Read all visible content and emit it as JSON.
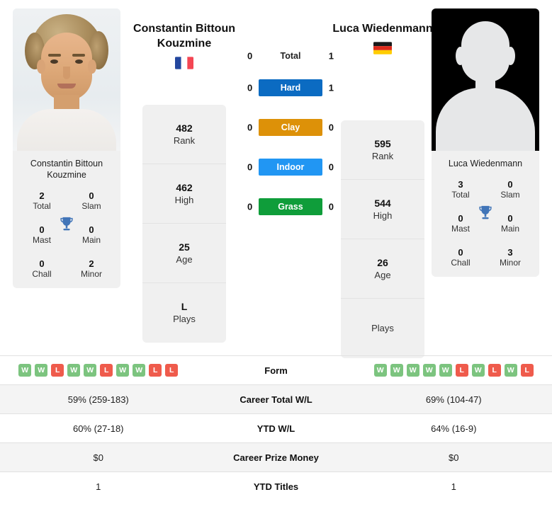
{
  "players": {
    "left": {
      "name": "Constantin Bittoun Kouzmine",
      "caption": "Constantin Bittoun Kouzmine",
      "flag": "fr",
      "flag_name": "france-flag",
      "photo_type": "headshot",
      "titles": [
        {
          "value": "2",
          "label": "Total"
        },
        {
          "value": "0",
          "label": "Slam"
        },
        {
          "value": "0",
          "label": "Mast"
        },
        {
          "value": "0",
          "label": "Main"
        },
        {
          "value": "0",
          "label": "Chall"
        },
        {
          "value": "2",
          "label": "Minor"
        }
      ],
      "card": [
        {
          "value": "482",
          "label": "Rank"
        },
        {
          "value": "462",
          "label": "High"
        },
        {
          "value": "25",
          "label": "Age"
        },
        {
          "value": "L",
          "label": "Plays"
        }
      ],
      "form": [
        "W",
        "W",
        "L",
        "W",
        "W",
        "L",
        "W",
        "W",
        "L",
        "L"
      ],
      "career_wl": "59% (259-183)",
      "ytd_wl": "60% (27-18)",
      "prize_money": "$0",
      "ytd_titles": "1"
    },
    "right": {
      "name": "Luca Wiedenmann",
      "caption": "Luca Wiedenmann",
      "flag": "de",
      "flag_name": "germany-flag",
      "photo_type": "silhouette",
      "titles": [
        {
          "value": "3",
          "label": "Total"
        },
        {
          "value": "0",
          "label": "Slam"
        },
        {
          "value": "0",
          "label": "Mast"
        },
        {
          "value": "0",
          "label": "Main"
        },
        {
          "value": "0",
          "label": "Chall"
        },
        {
          "value": "3",
          "label": "Minor"
        }
      ],
      "card": [
        {
          "value": "595",
          "label": "Rank"
        },
        {
          "value": "544",
          "label": "High"
        },
        {
          "value": "26",
          "label": "Age"
        },
        {
          "value": "",
          "label": "Plays"
        }
      ],
      "form": [
        "W",
        "W",
        "W",
        "W",
        "W",
        "L",
        "W",
        "L",
        "W",
        "L"
      ],
      "career_wl": "69% (104-47)",
      "ytd_wl": "64% (16-9)",
      "prize_money": "$0",
      "ytd_titles": "1"
    }
  },
  "head_to_head": [
    {
      "label": "Total",
      "left": "0",
      "right": "1",
      "color": "",
      "is_total": true
    },
    {
      "label": "Hard",
      "left": "0",
      "right": "1",
      "color": "#0b6bc2",
      "is_total": false
    },
    {
      "label": "Clay",
      "left": "0",
      "right": "0",
      "color": "#dd9108",
      "is_total": false
    },
    {
      "label": "Indoor",
      "left": "0",
      "right": "0",
      "color": "#2196f3",
      "is_total": false
    },
    {
      "label": "Grass",
      "left": "0",
      "right": "0",
      "color": "#0f9d3a",
      "is_total": false
    }
  ],
  "stats_rows": [
    {
      "label": "Form",
      "type": "form"
    },
    {
      "label": "Career Total W/L",
      "type": "text",
      "key": "career_wl"
    },
    {
      "label": "YTD W/L",
      "type": "text",
      "key": "ytd_wl"
    },
    {
      "label": "Career Prize Money",
      "type": "text",
      "key": "prize_money"
    },
    {
      "label": "YTD Titles",
      "type": "text",
      "key": "ytd_titles"
    }
  ],
  "icons": {
    "trophy": "trophy-icon"
  },
  "colors": {
    "win": "#7cc47f",
    "loss": "#ef5b4c",
    "panel": "#f0f0f0",
    "row_alt": "#f4f4f4"
  }
}
